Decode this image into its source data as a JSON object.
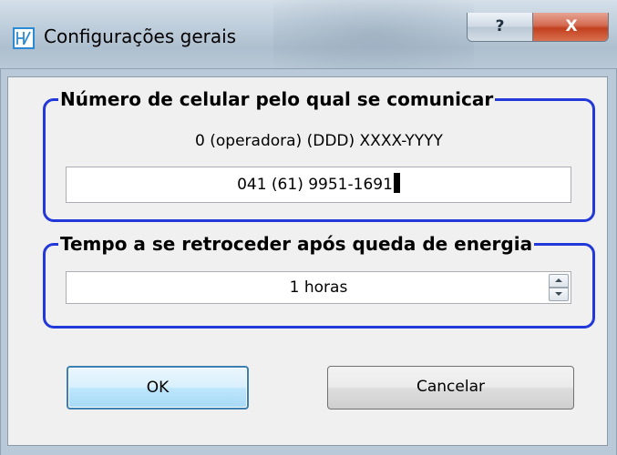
{
  "window": {
    "title": "Configurações gerais",
    "help_label": "?",
    "close_label": "X"
  },
  "phone_group": {
    "title": "Número de celular pelo qual se comunicar",
    "format_hint": "0 (operadora) (DDD) XXXX-YYYY",
    "value": "041 (61) 9951-1691"
  },
  "rollback_group": {
    "title": "Tempo a se retroceder após queda de energia",
    "value": "1 horas"
  },
  "buttons": {
    "ok_label": "OK",
    "cancel_label": "Cancelar"
  }
}
